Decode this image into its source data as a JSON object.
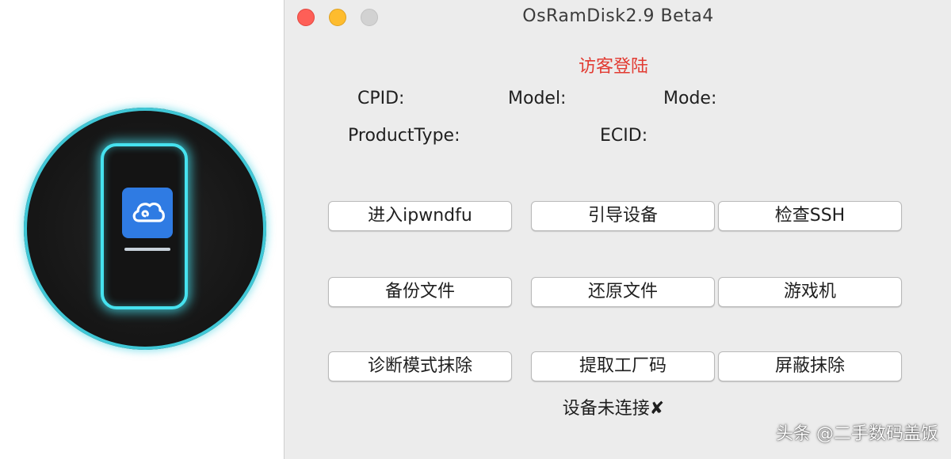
{
  "window": {
    "title": "OsRamDisk2.9 Beta4",
    "login_label": "访客登陆"
  },
  "device_info": {
    "cpid_label": "CPID:",
    "model_label": "Model:",
    "mode_label": "Mode:",
    "product_type_label": "ProductType:",
    "ecid_label": "ECID:"
  },
  "buttons": {
    "enter_dfu": "进入ipwndfu",
    "boot_device": "引导设备",
    "check_ssh": "检查SSH",
    "backup_files": "备份文件",
    "restore_files": "还原文件",
    "game_console": "游戏机",
    "diag_erase": "诊断模式抹除",
    "extract_factory": "提取工厂码",
    "block_erase": "屏蔽抹除"
  },
  "status": {
    "connection": "设备未连接✘"
  },
  "watermark": "头条 @二手数码盖饭",
  "icons": {
    "app_logo": "phone-cloud-icon",
    "cloud": "cloud-icon"
  },
  "colors": {
    "accent_red": "#e23b32",
    "logo_glow": "#46e2ef",
    "cloud_tile": "#2f7be3"
  }
}
